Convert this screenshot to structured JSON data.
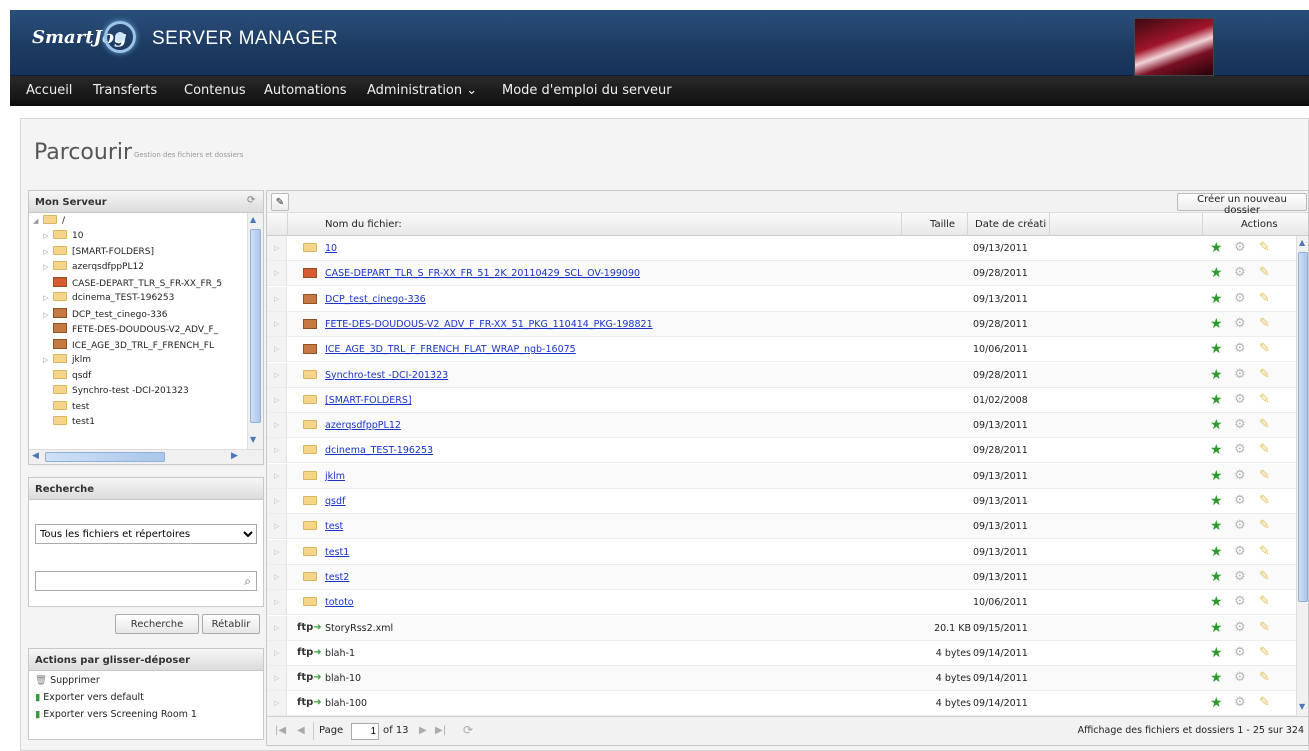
{
  "header": {
    "brand": "SmartJog",
    "product": "SERVER MANAGER"
  },
  "nav": [
    {
      "label": "Accueil"
    },
    {
      "label": "Transferts"
    },
    {
      "label": "Contenus"
    },
    {
      "label": "Automations"
    },
    {
      "label": "Administration ⌄"
    },
    {
      "label": "Mode d'emploi du serveur"
    }
  ],
  "page": {
    "title": "Parcourir",
    "subtitle": "Gestion des fichiers et dossiers"
  },
  "tree": {
    "title": "Mon Serveur",
    "root": "/",
    "items": [
      {
        "label": "10",
        "kind": "folder",
        "expand": "▷"
      },
      {
        "label": "[SMART-FOLDERS]",
        "kind": "folder",
        "expand": "▷"
      },
      {
        "label": "azerqsdfppPL12",
        "kind": "folder",
        "expand": "▷"
      },
      {
        "label": "CASE-DEPART_TLR_S_FR-XX_FR_5",
        "kind": "pkg-x",
        "expand": ""
      },
      {
        "label": "dcinema_TEST-196253",
        "kind": "folder",
        "expand": "▷"
      },
      {
        "label": "DCP_test_cinego-336",
        "kind": "pkg",
        "expand": "▷"
      },
      {
        "label": "FETE-DES-DOUDOUS-V2_ADV_F_",
        "kind": "pkg",
        "expand": ""
      },
      {
        "label": "ICE_AGE_3D_TRL_F_FRENCH_FL",
        "kind": "pkg",
        "expand": ""
      },
      {
        "label": "jklm",
        "kind": "folder",
        "expand": "▷"
      },
      {
        "label": "qsdf",
        "kind": "folder",
        "expand": ""
      },
      {
        "label": "Synchro-test -DCI-201323",
        "kind": "folder",
        "expand": ""
      },
      {
        "label": "test",
        "kind": "folder",
        "expand": ""
      },
      {
        "label": "test1",
        "kind": "folder",
        "expand": ""
      }
    ]
  },
  "search": {
    "title": "Recherche",
    "scope": "Tous les fichiers et répertoires",
    "query": "",
    "search_label": "Recherche",
    "reset_label": "Rétablir"
  },
  "dnd": {
    "title": "Actions par glisser-déposer",
    "items": [
      "Supprimer",
      "Exporter vers default",
      "Exporter vers Screening Room 1"
    ]
  },
  "grid": {
    "new_folder_label": "Créer un nouveau dossier",
    "toolbar_icon": "✎",
    "columns": {
      "name": "Nom du fichier:",
      "size": "Taille",
      "date": "Date de créati",
      "actions": "Actions"
    },
    "rows": [
      {
        "name": "10",
        "kind": "folder",
        "size": "",
        "date": "09/13/2011"
      },
      {
        "name": "CASE-DEPART_TLR_S_FR-XX_FR_51_2K_20110429_SCL_OV-199090",
        "kind": "pkg-x",
        "size": "",
        "date": "09/28/2011"
      },
      {
        "name": "DCP_test_cinego-336",
        "kind": "pkg",
        "size": "",
        "date": "09/13/2011"
      },
      {
        "name": "FETE-DES-DOUDOUS-V2_ADV_F_FR-XX_51_PKG_110414_PKG-198821",
        "kind": "pkg",
        "size": "",
        "date": "09/28/2011"
      },
      {
        "name": "ICE_AGE_3D_TRL_F_FRENCH_FLAT_WRAP_ngb-16075",
        "kind": "pkg",
        "size": "",
        "date": "10/06/2011"
      },
      {
        "name": "Synchro-test -DCI-201323",
        "kind": "folder",
        "size": "",
        "date": "09/28/2011"
      },
      {
        "name": "[SMART-FOLDERS]",
        "kind": "folder",
        "size": "",
        "date": "01/02/2008"
      },
      {
        "name": "azerqsdfppPL12",
        "kind": "folder",
        "size": "",
        "date": "09/13/2011"
      },
      {
        "name": "dcinema_TEST-196253",
        "kind": "folder",
        "size": "",
        "date": "09/28/2011"
      },
      {
        "name": "jklm",
        "kind": "folder",
        "size": "",
        "date": "09/13/2011"
      },
      {
        "name": "qsdf",
        "kind": "folder",
        "size": "",
        "date": "09/13/2011"
      },
      {
        "name": "test",
        "kind": "folder",
        "size": "",
        "date": "09/13/2011"
      },
      {
        "name": "test1",
        "kind": "folder",
        "size": "",
        "date": "09/13/2011"
      },
      {
        "name": "test2",
        "kind": "folder",
        "size": "",
        "date": "09/13/2011"
      },
      {
        "name": "tototo",
        "kind": "folder",
        "size": "",
        "date": "10/06/2011"
      },
      {
        "name": "StoryRss2.xml",
        "kind": "ftp",
        "size": "20.1 KB",
        "date": "09/15/2011"
      },
      {
        "name": "blah-1",
        "kind": "ftp",
        "size": "4 bytes",
        "date": "09/14/2011"
      },
      {
        "name": "blah-10",
        "kind": "ftp",
        "size": "4 bytes",
        "date": "09/14/2011"
      },
      {
        "name": "blah-100",
        "kind": "ftp",
        "size": "4 bytes",
        "date": "09/14/2011"
      }
    ],
    "ftp_label": "ftp",
    "pager": {
      "page_label": "Page",
      "page": "1",
      "of_label": "of 13",
      "summary": "Affichage des fichiers et dossiers 1 - 25 sur 324"
    }
  }
}
